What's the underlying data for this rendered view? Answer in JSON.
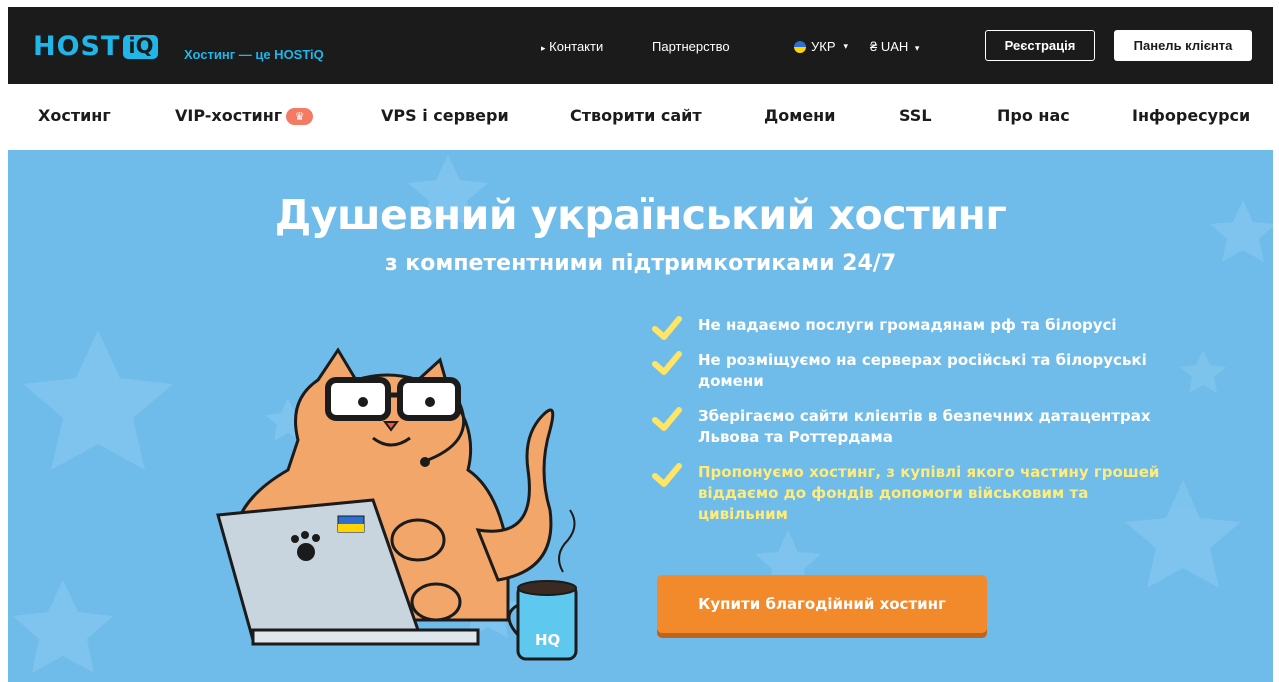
{
  "topbar": {
    "logo_text": "HOST",
    "logo_box_text": "iQ",
    "tagline": "Хостинг — це HOSTiQ",
    "contacts": "Контакти",
    "contacts_arrow": "▸",
    "partners": "Партнерство",
    "language": "УКР",
    "currency": "₴ UAH",
    "register_label": "Реєстрація",
    "panel_label": "Панель клієнта"
  },
  "nav": {
    "items": [
      {
        "label": "Хостинг"
      },
      {
        "label": "VIP-хостинг"
      },
      {
        "label": "VPS і сервери"
      },
      {
        "label": "Створити сайт"
      },
      {
        "label": "Домени"
      },
      {
        "label": "SSL"
      },
      {
        "label": "Про нас"
      },
      {
        "label": "Інфоресурси"
      }
    ],
    "vip_badge": "♛"
  },
  "hero": {
    "title": "Душевний український хостинг",
    "subtitle": "з компетентними підтримкотиками 24/7",
    "features": [
      {
        "text": "Не надаємо послуги громадянам рф та білорусі",
        "highlight": false
      },
      {
        "text": "Не розміщуємо на серверах російські та білоруські домени",
        "highlight": false
      },
      {
        "text": "Зберігаємо сайти клієнтів в безпечних датацентрах Львова та Роттердама",
        "highlight": false
      },
      {
        "text": "Пропонуємо хостинг, з купівлі якого частину грошей віддаємо до фондів допомоги військовим та цивільним",
        "highlight": true
      }
    ],
    "cta_label": "Купити благодійний хостинг",
    "mug_label": "HQ"
  },
  "colors": {
    "topbar_bg": "#1b1b1b",
    "brand_blue": "#1fb6e9",
    "hero_bg": "#6fbbe9",
    "cta_orange": "#f28a2c",
    "check_yellow": "#ffe566",
    "highlight_yellow": "#ffec7a"
  }
}
